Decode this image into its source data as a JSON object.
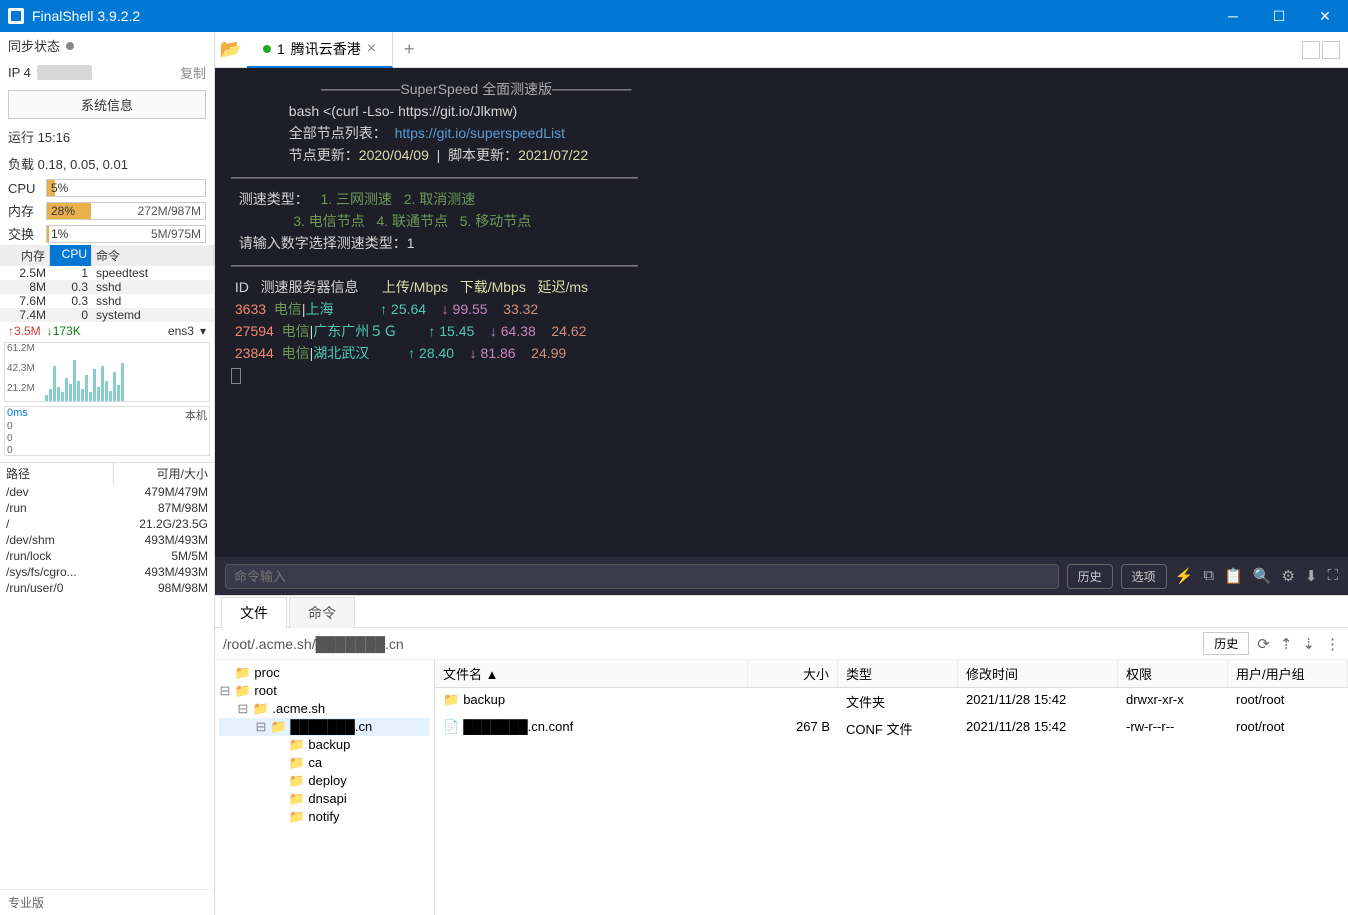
{
  "titlebar": {
    "title": "FinalShell 3.9.2.2"
  },
  "sidebar": {
    "sync_status_label": "同步状态",
    "ip_label": "IP 4",
    "ip_redacted": "██████",
    "copy_label": "复制",
    "system_info_button": "系统信息",
    "uptime": "运行 15:16",
    "load_label": "负载 0.18, 0.05, 0.01",
    "cpu_label": "CPU",
    "cpu_pct": "5%",
    "mem_label": "内存",
    "mem_pct": "28%",
    "mem_val": "272M/987M",
    "swap_label": "交换",
    "swap_pct": "1%",
    "swap_val": "5M/975M",
    "proc_headers": {
      "mem": "内存",
      "cpu": "CPU",
      "cmd": "命令"
    },
    "procs": [
      {
        "mem": "2.5M",
        "cpu": "1",
        "cmd": "speedtest"
      },
      {
        "mem": "8M",
        "cpu": "0.3",
        "cmd": "sshd"
      },
      {
        "mem": "7.6M",
        "cpu": "0.3",
        "cmd": "sshd"
      },
      {
        "mem": "7.4M",
        "cpu": "0",
        "cmd": "systemd"
      }
    ],
    "net_up": "↑3.5M",
    "net_down": "↓173K",
    "net_if": "ens3",
    "chart_y": [
      "61.2M",
      "42.3M",
      "21.2M"
    ],
    "lat_label": "0ms",
    "lat_host": "本机",
    "lat_vals": [
      "0",
      "0",
      "0"
    ],
    "path_headers": {
      "path": "路径",
      "avail": "可用/大小"
    },
    "paths": [
      {
        "p": "/dev",
        "v": "479M/479M"
      },
      {
        "p": "/run",
        "v": "87M/98M"
      },
      {
        "p": "/",
        "v": "21.2G/23.5G"
      },
      {
        "p": "/dev/shm",
        "v": "493M/493M"
      },
      {
        "p": "/run/lock",
        "v": "5M/5M"
      },
      {
        "p": "/sys/fs/cgro...",
        "v": "493M/493M"
      },
      {
        "p": "/run/user/0",
        "v": "98M/98M"
      }
    ],
    "edition": "专业版"
  },
  "tabs": {
    "active": {
      "index": "1",
      "name": "腾讯云香港"
    },
    "plus": "+"
  },
  "terminal": {
    "title_line": "────────SuperSpeed 全面测速版────────",
    "bash_line": "bash <(curl -Lso- https://git.io/Jlkmw)",
    "nodes_label": "全部节点列表：",
    "nodes_url": "https://git.io/superspeedList",
    "update_line_label": "节点更新：",
    "update_date": "2020/04/09",
    "script_label": "脚本更新：",
    "script_date": "2021/07/22",
    "divider": "─────────────────────────────────────────",
    "type_label": "测速类型：",
    "opts": [
      "1. 三网测速",
      "2. 取消测速",
      "3. 电信节点",
      "4. 联通节点",
      "5. 移动节点"
    ],
    "prompt": "请输入数字选择测速类型：",
    "prompt_val": "1",
    "thead": {
      "id": "ID",
      "server": "测速服务器信息",
      "up": "上传/Mbps",
      "down": "下载/Mbps",
      "lat": "延迟/ms"
    },
    "rows": [
      {
        "id": "3633",
        "isp": "电信",
        "loc": "上海",
        "up": "25.64",
        "down": "99.55",
        "lat": "33.32"
      },
      {
        "id": "27594",
        "isp": "电信",
        "loc": "广东广州５Ｇ",
        "up": "15.45",
        "down": "64.38",
        "lat": "24.62"
      },
      {
        "id": "23844",
        "isp": "电信",
        "loc": "湖北武汉",
        "up": "28.40",
        "down": "81.86",
        "lat": "24.99"
      }
    ]
  },
  "cmdbar": {
    "placeholder": "命令输入",
    "history_btn": "历史",
    "options_btn": "选项"
  },
  "filepanel": {
    "tabs": {
      "file": "文件",
      "cmd": "命令"
    },
    "breadcrumb": "/root/.acme.sh/███████.cn",
    "history_btn": "历史",
    "tree": [
      {
        "indent": 0,
        "name": "proc",
        "toggle": ""
      },
      {
        "indent": 0,
        "name": "root",
        "toggle": "⊟"
      },
      {
        "indent": 1,
        "name": ".acme.sh",
        "toggle": "⊟"
      },
      {
        "indent": 2,
        "name": "███████.cn",
        "toggle": "⊟",
        "sel": true
      },
      {
        "indent": 3,
        "name": "backup",
        "toggle": ""
      },
      {
        "indent": 3,
        "name": "ca",
        "toggle": ""
      },
      {
        "indent": 3,
        "name": "deploy",
        "toggle": ""
      },
      {
        "indent": 3,
        "name": "dnsapi",
        "toggle": ""
      },
      {
        "indent": 3,
        "name": "notify",
        "toggle": ""
      }
    ],
    "columns": {
      "name": "文件名 ▲",
      "size": "大小",
      "type": "类型",
      "mtime": "修改时间",
      "perm": "权限",
      "user": "用户/用户组"
    },
    "files": [
      {
        "icon": "📁",
        "name": "backup",
        "size": "",
        "type": "文件夹",
        "mtime": "2021/11/28 15:42",
        "perm": "drwxr-xr-x",
        "user": "root/root"
      },
      {
        "icon": "📄",
        "name": "███████.cn.conf",
        "size": "267 B",
        "type": "CONF 文件",
        "mtime": "2021/11/28 15:42",
        "perm": "-rw-r--r--",
        "user": "root/root"
      }
    ]
  }
}
